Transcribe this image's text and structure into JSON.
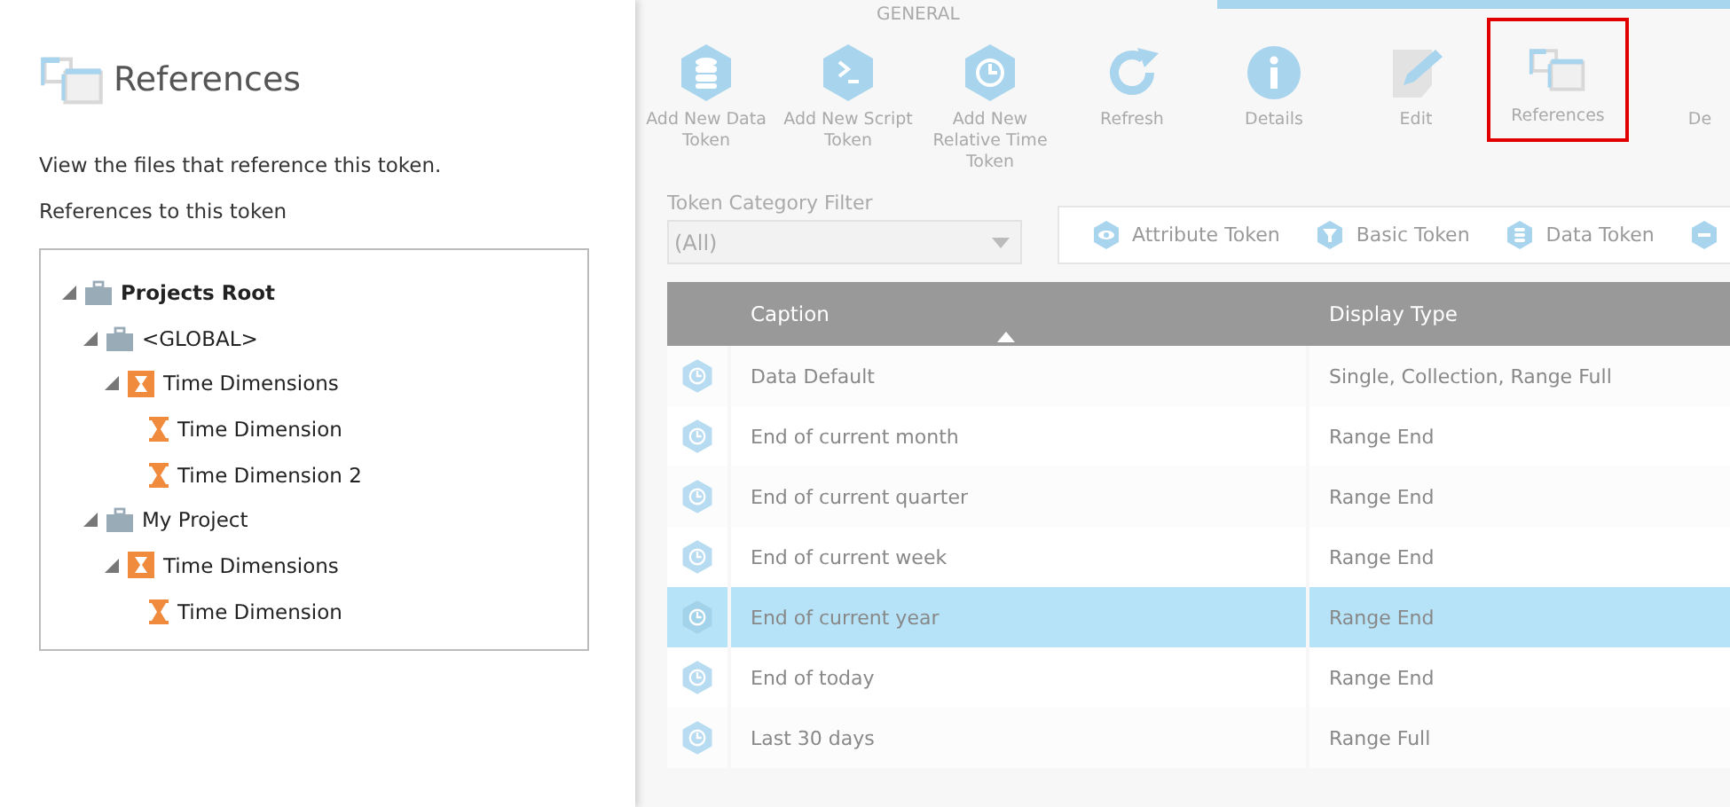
{
  "panel": {
    "title": "References",
    "description": "View the files that reference this token.",
    "tree_label": "References to this token",
    "tree": [
      {
        "kind": "root",
        "label": "Projects Root",
        "expanded": true,
        "children": [
          {
            "kind": "project",
            "label": "<GLOBAL>",
            "expanded": true,
            "children": [
              {
                "kind": "folder",
                "label": "Time Dimensions",
                "expanded": true,
                "children": [
                  {
                    "kind": "item",
                    "label": "Time Dimension"
                  },
                  {
                    "kind": "item",
                    "label": "Time Dimension 2"
                  }
                ]
              }
            ]
          },
          {
            "kind": "project",
            "label": "My Project",
            "expanded": true,
            "children": [
              {
                "kind": "folder",
                "label": "Time Dimensions",
                "expanded": true,
                "children": [
                  {
                    "kind": "item",
                    "label": "Time Dimension"
                  }
                ]
              }
            ]
          }
        ]
      }
    ]
  },
  "toolbar": {
    "group_label": "GENERAL",
    "buttons": [
      {
        "kind": "data",
        "label": "Add New Data Token",
        "highlighted": false
      },
      {
        "kind": "script",
        "label": "Add New Script Token",
        "highlighted": false
      },
      {
        "kind": "clock",
        "label": "Add New Relative Time Token",
        "highlighted": false
      },
      {
        "kind": "refresh",
        "label": "Refresh",
        "highlighted": false
      },
      {
        "kind": "divider"
      },
      {
        "kind": "info",
        "label": "Details",
        "highlighted": false
      },
      {
        "kind": "edit",
        "label": "Edit",
        "highlighted": false
      },
      {
        "kind": "references",
        "label": "References",
        "highlighted": true
      },
      {
        "kind": "delete",
        "label": "De",
        "highlighted": false
      }
    ]
  },
  "filter": {
    "label": "Token Category Filter",
    "value": "(All)",
    "chips": [
      {
        "kind": "eye",
        "label": "Attribute Token"
      },
      {
        "kind": "funnel",
        "label": "Basic Token"
      },
      {
        "kind": "data",
        "label": "Data Token"
      },
      {
        "kind": "dots"
      }
    ]
  },
  "table": {
    "columns": [
      {
        "label": "Caption",
        "sorted": true
      },
      {
        "label": "Display Type",
        "sorted": false
      }
    ],
    "rows": [
      {
        "caption": "Data Default",
        "display_type": "Single, Collection, Range Full",
        "selected": false
      },
      {
        "caption": "End of current month",
        "display_type": "Range End",
        "selected": false
      },
      {
        "caption": "End of current quarter",
        "display_type": "Range End",
        "selected": false
      },
      {
        "caption": "End of current week",
        "display_type": "Range End",
        "selected": false
      },
      {
        "caption": "End of current year",
        "display_type": "Range End",
        "selected": true
      },
      {
        "caption": "End of today",
        "display_type": "Range End",
        "selected": false
      },
      {
        "caption": "Last 30 days",
        "display_type": "Range Full",
        "selected": false
      }
    ]
  }
}
